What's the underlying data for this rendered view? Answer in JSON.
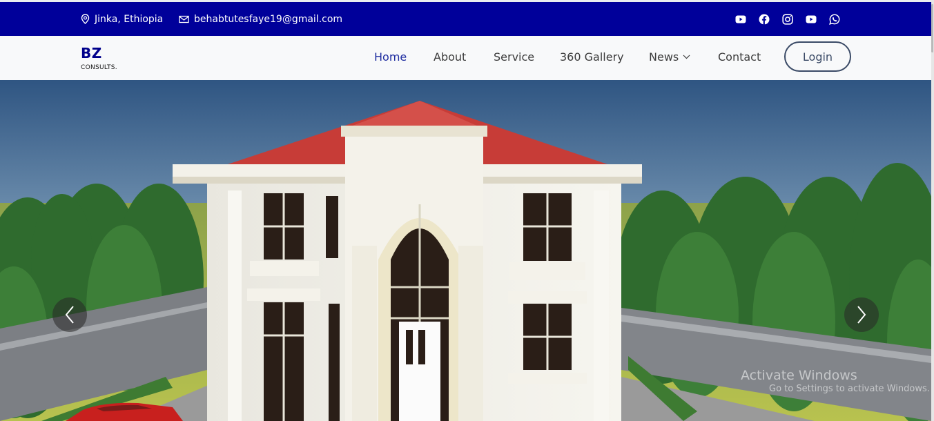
{
  "topbar": {
    "location": "Jinka, Ethiopia",
    "email": "behabtutesfaye19@gmail.com",
    "social_icons": [
      "youtube-icon",
      "facebook-icon",
      "instagram-icon",
      "youtube-icon",
      "whatsapp-icon"
    ],
    "background": "#00009a"
  },
  "brand": {
    "name": "BZ",
    "subtitle": "CONSULTS."
  },
  "nav": {
    "items": [
      {
        "label": "Home",
        "active": true
      },
      {
        "label": "About"
      },
      {
        "label": "Service"
      },
      {
        "label": "360 Gallery"
      },
      {
        "label": "News",
        "dropdown": true
      },
      {
        "label": "Contact"
      }
    ],
    "login_label": "Login"
  },
  "hero": {
    "prev_icon": "chevron-left-icon",
    "next_icon": "chevron-right-icon"
  },
  "watermark": {
    "title": "Activate Windows",
    "subtitle": "Go to Settings to activate Windows."
  }
}
